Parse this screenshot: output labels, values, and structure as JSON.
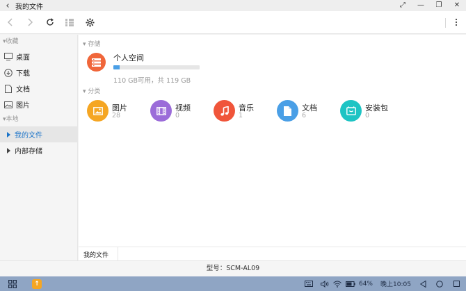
{
  "titlebar": {
    "back_icon": "chevron-left-icon",
    "title": "我的文件"
  },
  "toolbar": {
    "icons": [
      "back-arrow-icon",
      "forward-arrow-icon",
      "refresh-icon",
      "view-toggle-icon",
      "settings-icon",
      "more-icon"
    ]
  },
  "sidebar": {
    "favorites_label": "收藏",
    "favorites": [
      {
        "label": "桌面",
        "icon": "desktop-icon"
      },
      {
        "label": "下载",
        "icon": "download-icon"
      },
      {
        "label": "文档",
        "icon": "document-icon"
      },
      {
        "label": "图片",
        "icon": "picture-icon"
      }
    ],
    "local_label": "本地",
    "local": [
      {
        "label": "我的文件",
        "active": true
      },
      {
        "label": "内部存储",
        "active": false
      }
    ]
  },
  "main": {
    "storage_label": "存储",
    "storage": {
      "name": "个人空间",
      "info": "110 GB可用，共 119 GB",
      "used_fraction": 0.07,
      "color": "#f0663a"
    },
    "category_label": "分类",
    "categories": [
      {
        "label": "图片",
        "count": "28",
        "color": "#f5a623",
        "icon": "image-icon"
      },
      {
        "label": "视频",
        "count": "0",
        "color": "#9b6cd9",
        "icon": "video-icon"
      },
      {
        "label": "音乐",
        "count": "1",
        "color": "#f0553a",
        "icon": "music-icon"
      },
      {
        "label": "文档",
        "count": "6",
        "color": "#4a9fe6",
        "icon": "document-icon"
      },
      {
        "label": "安装包",
        "count": "0",
        "color": "#1ec4c4",
        "icon": "package-icon"
      }
    ]
  },
  "pathbar": {
    "crumb": "我的文件"
  },
  "status": {
    "text": "型号：SCM-AL09"
  },
  "taskbar": {
    "battery": "64%",
    "time": "晚上10:05"
  }
}
